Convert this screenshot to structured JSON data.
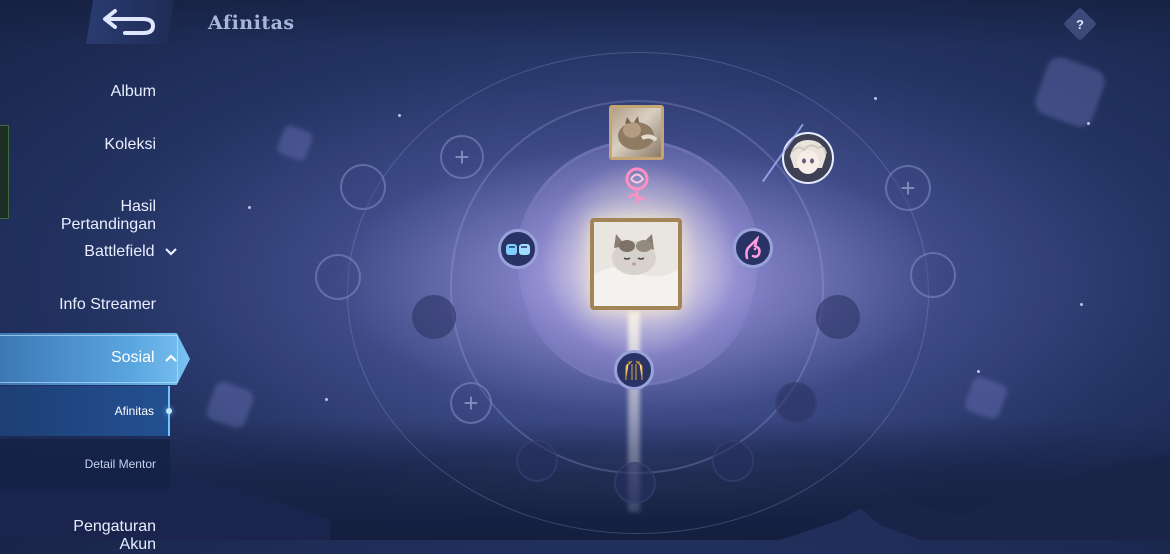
{
  "header": {
    "title": "Afinitas",
    "help_label": "?"
  },
  "sidebar": {
    "items": [
      {
        "label": "Album"
      },
      {
        "label": "Koleksi"
      },
      {
        "label": "Hasil\nPertandingan"
      },
      {
        "label": "Battlefield",
        "expand": "collapsed"
      },
      {
        "label": "Info Streamer"
      },
      {
        "label": "Sosial",
        "expand": "expanded",
        "active": true
      },
      {
        "label": "Pengaturan\nAkun"
      }
    ],
    "subitems": [
      {
        "label": "Afinitas",
        "active": true
      },
      {
        "label": "Detail Mentor",
        "active": false
      }
    ]
  },
  "affinity": {
    "relations": [
      {
        "icon": "rose-icon",
        "color": "#ff8fc2"
      },
      {
        "icon": "fist-bump-icon",
        "color": "#7fd0ff"
      },
      {
        "icon": "unicorn-icon",
        "color": "#ff9de0"
      },
      {
        "icon": "high-five-hands-icon",
        "color": "#ffd86a"
      }
    ]
  },
  "colors": {
    "accent": "#5aa6e0",
    "title": "#a9b6d8",
    "avatar_frame": "#a38456"
  }
}
